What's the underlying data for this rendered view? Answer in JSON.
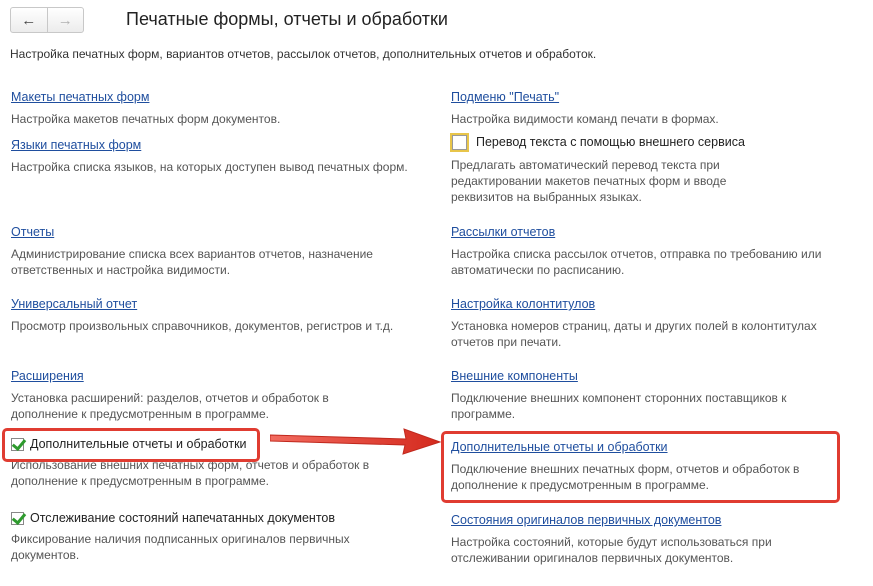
{
  "nav": {
    "back_icon": "←",
    "forward_icon": "→"
  },
  "page": {
    "title": "Печатные формы, отчеты и обработки",
    "subtitle": "Настройка печатных форм, вариантов отчетов, рассылок отчетов, дополнительных отчетов и обработок."
  },
  "left": [
    {
      "link": "Макеты печатных форм",
      "desc": "Настройка макетов печатных форм документов."
    },
    {
      "link": "Языки печатных форм",
      "desc": "Настройка списка языков, на которых доступен вывод печатных форм."
    },
    {
      "link": "Отчеты",
      "desc": "Администрирование списка всех вариантов отчетов, назначение ответственных и настройка видимости."
    },
    {
      "link": "Универсальный отчет",
      "desc": "Просмотр произвольных справочников, документов, регистров и т.д."
    },
    {
      "link": "Расширения",
      "desc": "Установка расширений: разделов, отчетов и обработок в дополнение к предусмотренным в программе."
    },
    {
      "check_label": "Дополнительные отчеты и обработки",
      "checked": true,
      "desc": "Использование внешних печатных форм, отчетов и обработок в дополнение к предусмотренным в программе."
    },
    {
      "check_label": "Отслеживание состояний напечатанных документов",
      "checked": true,
      "desc": "Фиксирование наличия подписанных оригиналов первичных документов."
    }
  ],
  "right": [
    {
      "link": "Подменю \"Печать\"",
      "desc": "Настройка видимости команд печати в формах."
    },
    {
      "check_label": "Перевод текста с помощью внешнего сервиса",
      "checked": false,
      "desc": "Предлагать автоматический перевод текста при редактировании макетов печатных форм и вводе реквизитов на выбранных языках."
    },
    {
      "link": "Рассылки отчетов",
      "desc": "Настройка списка рассылок отчетов, отправка по требованию или автоматически по расписанию."
    },
    {
      "link": "Настройка колонтитулов",
      "desc": "Установка номеров страниц, даты и других полей в колонтитулах отчетов при печати."
    },
    {
      "link": "Внешние компоненты",
      "desc": "Подключение внешних компонент сторонних поставщиков к программе."
    },
    {
      "link": "Дополнительные отчеты и обработки",
      "desc": "Подключение внешних печатных форм, отчетов и обработок в дополнение к предусмотренным в программе."
    },
    {
      "link": "Состояния оригиналов первичных документов",
      "desc": "Настройка состояний, которые будут использоваться при отслеживании оригиналов первичных документов."
    }
  ],
  "colors": {
    "link": "#1f4e9e",
    "highlight": "#e03c31",
    "check": "#2d9a2d"
  }
}
